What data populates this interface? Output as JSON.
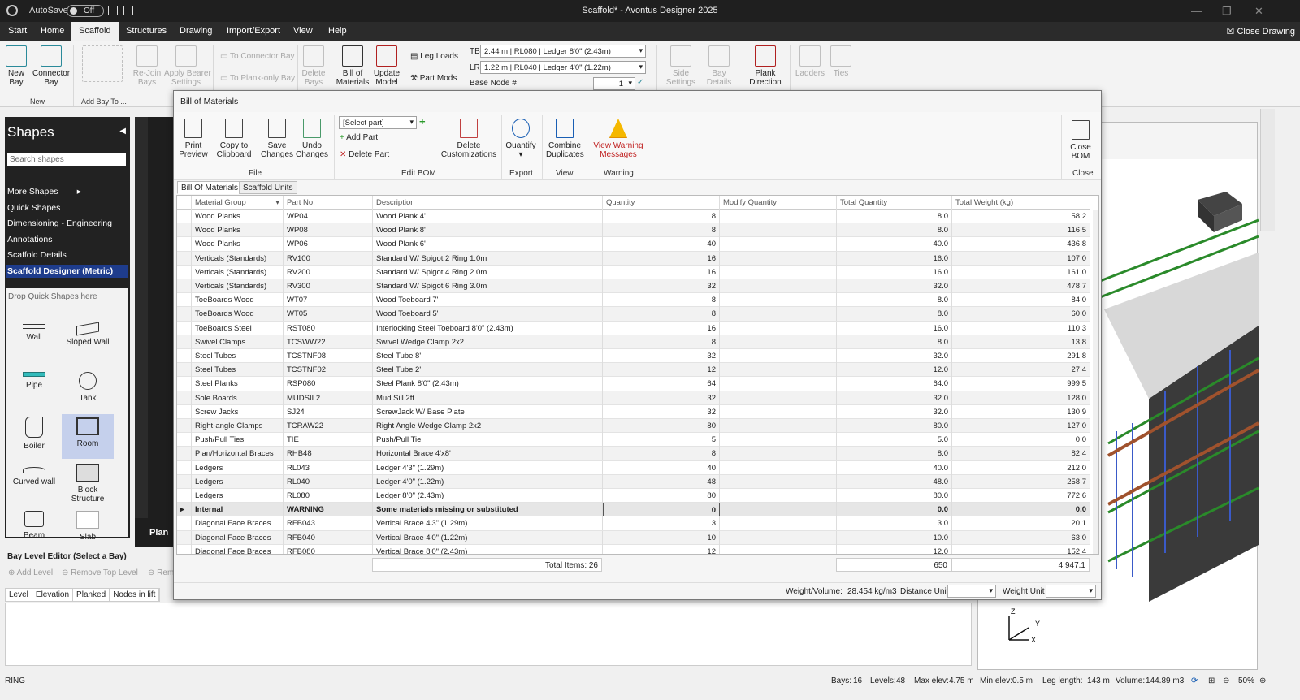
{
  "app": {
    "title": "Scaffold* - Avontus Designer 2025",
    "autosave_label": "AutoSave",
    "autosave_state": "Off"
  },
  "menu": {
    "items": [
      "Start",
      "Home",
      "Scaffold",
      "Structures",
      "Drawing",
      "Import/Export",
      "View",
      "Help"
    ],
    "active": "Scaffold",
    "close_drawing": "Close Drawing"
  },
  "ribbon": {
    "new_bay": "New\nBay",
    "connector_bay": "Connector\nBay",
    "group_new": "New",
    "group_add_bay": "Add Bay To ...",
    "rejoin": "Re-Join\nBays",
    "apply_bearer": "Apply Bearer\nSettings",
    "to_connector_bay": "To Connector Bay",
    "to_plank_only_bay": "To Plank-only Bay",
    "delete_bays": "Delete\nBays",
    "bill_of_materials": "Bill of\nMaterials",
    "update_model": "Update\nModel",
    "leg_loads": "Leg Loads",
    "part_mods": "Part Mods",
    "tb_label": "TB",
    "tb_value": "2.44 m | RL080 | Ledger 8'0\" (2.43m)",
    "lr_label": "LR",
    "lr_value": "1.22 m | RL040 | Ledger 4'0\" (1.22m)",
    "base_node_label": "Base Node #",
    "base_node_value": "1",
    "side_settings": "Side\nSettings",
    "bay_details": "Bay\nDetails",
    "plank_direction": "Plank\nDirection",
    "ladders": "Ladders",
    "ties": "Ties"
  },
  "shapes_panel": {
    "title": "Shapes",
    "search_placeholder": "Search shapes",
    "categories": [
      "More Shapes",
      "Quick Shapes",
      "Dimensioning - Engineering",
      "Annotations",
      "Scaffold Details",
      "Scaffold Designer (Metric)"
    ],
    "selected_category": "Scaffold Designer (Metric)",
    "drop_tip": "Drop Quick Shapes here",
    "shapes": [
      "Wall",
      "Sloped Wall",
      "Pipe",
      "Tank",
      "Boiler",
      "Room",
      "Curved wall",
      "Block\nStructure",
      "Beam",
      "Slab"
    ]
  },
  "drawing": {
    "tab": "Plan"
  },
  "bay_editor": {
    "title": "Bay Level Editor (Select a Bay)",
    "add_level": "Add Level",
    "remove_top_level": "Remove Top Level",
    "rem": "Rem",
    "columns": [
      "Level",
      "Elevation",
      "Planked",
      "Nodes in lift"
    ]
  },
  "status": {
    "mode": "RING",
    "bays_label": "Bays:",
    "bays": "16",
    "levels_label": "Levels:",
    "levels": "48",
    "max_elev_label": "Max elev:",
    "max_elev": "4.75 m",
    "min_elev_label": "Min elev:",
    "min_elev": "0.5 m",
    "leg_length_label": "Leg length:",
    "leg_length": "143 m",
    "volume_label": "Volume:",
    "volume": "144.89 m3",
    "zoom": "50%"
  },
  "bom": {
    "title": "Bill of Materials",
    "ribbon": {
      "print_preview": "Print\nPreview",
      "copy_clipboard": "Copy to\nClipboard",
      "save_changes": "Save\nChanges",
      "undo_changes": "Undo\nChanges",
      "group_file": "File",
      "select_part": "[Select part]",
      "add_part": "Add Part",
      "delete_part": "Delete Part",
      "delete_customizations": "Delete\nCustomizations",
      "group_edit": "Edit BOM",
      "quantify": "Quantify",
      "group_export": "Export",
      "combine_duplicates": "Combine\nDuplicates",
      "group_view": "View",
      "view_warning": "View Warning\nMessages",
      "group_warning": "Warning",
      "close_bom": "Close\nBOM",
      "group_close": "Close"
    },
    "tabs": [
      "Bill Of Materials",
      "Scaffold Units"
    ],
    "columns": [
      "Material Group",
      "Part No.",
      "Description",
      "Quantity",
      "Modify Quantity",
      "Total Quantity",
      "Total Weight (kg)"
    ],
    "rows": [
      [
        "Wood Planks",
        "WP04",
        "Wood Plank 4'",
        "8",
        "",
        "8.0",
        "58.2"
      ],
      [
        "Wood Planks",
        "WP08",
        "Wood Plank 8'",
        "8",
        "",
        "8.0",
        "116.5"
      ],
      [
        "Wood Planks",
        "WP06",
        "Wood Plank 6'",
        "40",
        "",
        "40.0",
        "436.8"
      ],
      [
        "Verticals (Standards)",
        "RV100",
        "Standard W/ Spigot 2 Ring 1.0m",
        "16",
        "",
        "16.0",
        "107.0"
      ],
      [
        "Verticals (Standards)",
        "RV200",
        "Standard W/ Spigot 4 Ring 2.0m",
        "16",
        "",
        "16.0",
        "161.0"
      ],
      [
        "Verticals (Standards)",
        "RV300",
        "Standard W/ Spigot 6 Ring 3.0m",
        "32",
        "",
        "32.0",
        "478.7"
      ],
      [
        "ToeBoards Wood",
        "WT07",
        "Wood Toeboard 7'",
        "8",
        "",
        "8.0",
        "84.0"
      ],
      [
        "ToeBoards Wood",
        "WT05",
        "Wood Toeboard 5'",
        "8",
        "",
        "8.0",
        "60.0"
      ],
      [
        "ToeBoards Steel",
        "RST080",
        "Interlocking Steel Toeboard 8'0\" (2.43m)",
        "16",
        "",
        "16.0",
        "110.3"
      ],
      [
        "Swivel Clamps",
        "TCSWW22",
        "Swivel Wedge Clamp 2x2",
        "8",
        "",
        "8.0",
        "13.8"
      ],
      [
        "Steel Tubes",
        "TCSTNF08",
        "Steel Tube 8'",
        "32",
        "",
        "32.0",
        "291.8"
      ],
      [
        "Steel Tubes",
        "TCSTNF02",
        "Steel Tube 2'",
        "12",
        "",
        "12.0",
        "27.4"
      ],
      [
        "Steel Planks",
        "RSP080",
        "Steel Plank 8'0\" (2.43m)",
        "64",
        "",
        "64.0",
        "999.5"
      ],
      [
        "Sole Boards",
        "MUDSIL2",
        "Mud Sill 2ft",
        "32",
        "",
        "32.0",
        "128.0"
      ],
      [
        "Screw Jacks",
        "SJ24",
        "ScrewJack W/ Base Plate",
        "32",
        "",
        "32.0",
        "130.9"
      ],
      [
        "Right-angle Clamps",
        "TCRAW22",
        "Right Angle Wedge Clamp 2x2",
        "80",
        "",
        "80.0",
        "127.0"
      ],
      [
        "Push/Pull Ties",
        "TIE",
        "Push/Pull Tie",
        "5",
        "",
        "5.0",
        "0.0"
      ],
      [
        "Plan/Horizontal Braces",
        "RHB48",
        "Horizontal Brace 4'x8'",
        "8",
        "",
        "8.0",
        "82.4"
      ],
      [
        "Ledgers",
        "RL043",
        "Ledger 4'3\" (1.29m)",
        "40",
        "",
        "40.0",
        "212.0"
      ],
      [
        "Ledgers",
        "RL040",
        "Ledger 4'0\" (1.22m)",
        "48",
        "",
        "48.0",
        "258.7"
      ],
      [
        "Ledgers",
        "RL080",
        "Ledger 8'0\" (2.43m)",
        "80",
        "",
        "80.0",
        "772.6"
      ],
      [
        "Internal",
        "WARNING",
        "Some materials missing or substituted",
        "0",
        "",
        "0.0",
        "0.0"
      ],
      [
        "Diagonal Face Braces",
        "RFB043",
        "Vertical Brace 4'3\" (1.29m)",
        "3",
        "",
        "3.0",
        "20.1"
      ],
      [
        "Diagonal Face Braces",
        "RFB040",
        "Vertical Brace 4'0\" (1.22m)",
        "10",
        "",
        "10.0",
        "63.0"
      ],
      [
        "Diagonal Face Braces",
        "RFB080",
        "Vertical Brace 8'0\" (2.43m)",
        "12",
        "",
        "12.0",
        "152.4"
      ]
    ],
    "footer": {
      "total_items": "Total Items: 26",
      "total_quantity": "650",
      "total_weight": "4,947.1"
    },
    "statusbar": {
      "weight_volume_label": "Weight/Volume:",
      "weight_volume": "28.454 kg/m3",
      "distance_unit_label": "Distance Unit",
      "weight_unit_label": "Weight Unit"
    }
  }
}
